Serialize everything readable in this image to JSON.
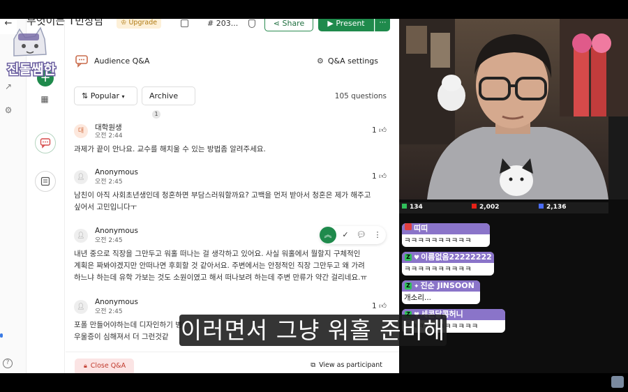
{
  "toolbar": {
    "title": "무엇이든 T민상담",
    "upgrade_label": "Upgrade",
    "session_number": "# 203...",
    "share_label": "Share",
    "present_label": "Present"
  },
  "logo_text": "진돌쌤한",
  "qa": {
    "header_title": "Audience Q&A",
    "settings_label": "Q&A settings",
    "sort_label": "Popular",
    "archive_label": "Archive",
    "archive_count": "1",
    "question_count": "105 questions",
    "questions": [
      {
        "avatar": "대",
        "name": "대학원생",
        "time": "오전 2:44",
        "likes": "1",
        "text": "과제가 끝이 안나요. 교수를 해치울 수 있는 방법좀 알려주세요."
      },
      {
        "avatar": "",
        "name": "Anonymous",
        "time": "오전 2:45",
        "likes": "1",
        "text": "남친이 아직 사회초년생인데 청혼하면 부담스러워할까요? 고백을 먼저 받아서 청혼은 제가 해주고 싶어서 고민입니다ㅜ"
      },
      {
        "avatar": "",
        "name": "Anonymous",
        "time": "오전 2:45",
        "likes": "",
        "text": "내년 중으로 직장을 그만두고 워홀 떠나는 걸 생각하고 있어요. 사실 워홀에서 뭘할지 구체적인 계획은 짜봐야겠지만 안떠나면 후회할 것 같아서요. 주변에서는 안정적인 직장 그만두고 왜 가려 하느냐 하는데 유학 가보는 것도 소원이였고 해서 떠나보려 하는데 주변 만류가 약간 걸리네요.ㅠ"
      },
      {
        "avatar": "",
        "name": "Anonymous",
        "time": "오전 2:45",
        "likes": "1",
        "text": "포폴 만들어야하는데 디자인하기 병/우울증이 심해져서 더 그런것같"
      }
    ],
    "close_label": "Close Q&A",
    "participant_label": "View as participant"
  },
  "stats": {
    "chzzk": "134",
    "youtube": "2,002",
    "other": "2,136"
  },
  "chat": [
    {
      "name": "띠띠",
      "message": "ㅋㅋㅋㅋㅋㅋㅋㅋㅋㅋ",
      "color": "#8a74c9"
    },
    {
      "name": "이름없음22222222",
      "message": "ㅋㅋㅋㅋㅋㅋㅋㅋㅋㅋ",
      "color": "#8a74c9"
    },
    {
      "name": "진순 JINSOON",
      "message": "개소리...",
      "color": "#8a74c9"
    },
    {
      "name": "세콘달콤허니",
      "message": "ㅋㅋㅋㅋㅋㅋㅋㅋㅋㅋㅋ",
      "color": "#8a74c9"
    }
  ],
  "subtitle": "이러면서 그냥 워홀 준비해",
  "colors": {
    "accent_green": "#1f8a4c",
    "chat_name_bg": "#8a74c9",
    "close_bg": "#fbe4e4"
  }
}
